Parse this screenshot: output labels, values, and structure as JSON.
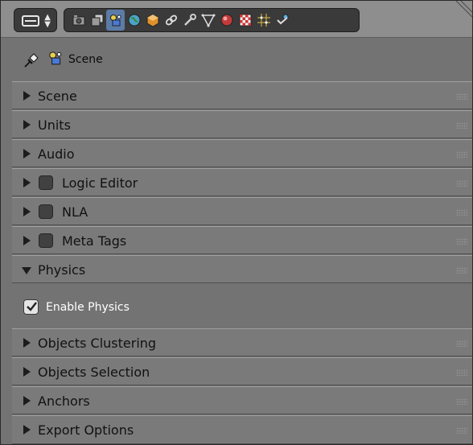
{
  "header": {
    "editor_type_icon": "properties-editor-icon",
    "tabs": [
      {
        "icon": "render-icon",
        "active": false
      },
      {
        "icon": "render-layers-icon",
        "active": false
      },
      {
        "icon": "scene-icon",
        "active": true
      },
      {
        "icon": "world-icon",
        "active": false
      },
      {
        "icon": "object-icon",
        "active": false
      },
      {
        "icon": "constraints-icon",
        "active": false
      },
      {
        "icon": "modifiers-icon",
        "active": false
      },
      {
        "icon": "object-data-icon",
        "active": false
      },
      {
        "icon": "material-icon",
        "active": false
      },
      {
        "icon": "texture-icon",
        "active": false
      },
      {
        "icon": "particles-icon",
        "active": false
      },
      {
        "icon": "physics-icon",
        "active": false
      }
    ]
  },
  "context": {
    "label": "Scene"
  },
  "panels": [
    {
      "label": "Scene",
      "expanded": false,
      "checkbox": false
    },
    {
      "label": "Units",
      "expanded": false,
      "checkbox": false
    },
    {
      "label": "Audio",
      "expanded": false,
      "checkbox": false
    },
    {
      "label": "Logic Editor",
      "expanded": false,
      "checkbox": true
    },
    {
      "label": "NLA",
      "expanded": false,
      "checkbox": true
    },
    {
      "label": "Meta Tags",
      "expanded": false,
      "checkbox": true
    },
    {
      "label": "Physics",
      "expanded": true,
      "checkbox": false
    },
    {
      "label": "Objects Clustering",
      "expanded": false,
      "checkbox": false
    },
    {
      "label": "Objects Selection",
      "expanded": false,
      "checkbox": false
    },
    {
      "label": "Anchors",
      "expanded": false,
      "checkbox": false
    },
    {
      "label": "Export Options",
      "expanded": false,
      "checkbox": false
    }
  ],
  "physics": {
    "enable_label": "Enable Physics",
    "enabled": true
  },
  "colors": {
    "active_tab": "#5c7ca8",
    "panel_bg": "#7a7a7a"
  }
}
